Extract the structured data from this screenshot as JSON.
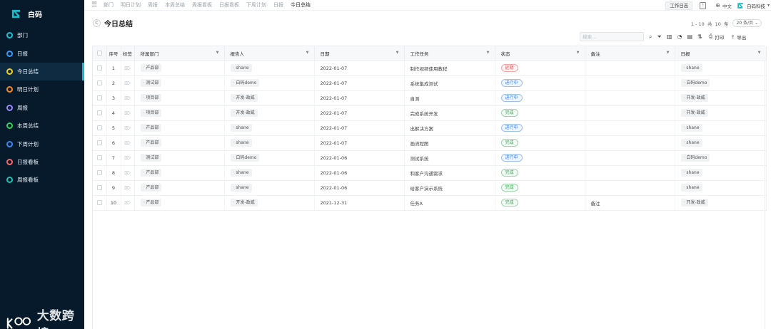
{
  "app": {
    "name": "白码",
    "brand_color": "#18b8c8"
  },
  "sidebar": {
    "items": [
      {
        "label": "部门",
        "ring_color": "#19c2cc",
        "active": false
      },
      {
        "label": "日报",
        "ring_color": "#3b9cf5",
        "active": false
      },
      {
        "label": "今日总结",
        "ring_color": "#f5d11c",
        "active": true
      },
      {
        "label": "明日计划",
        "ring_color": "#f08a2a",
        "active": false
      },
      {
        "label": "周报",
        "ring_color": "#9b8af7",
        "active": false
      },
      {
        "label": "本周总结",
        "ring_color": "#2dd35c",
        "active": false
      },
      {
        "label": "下周计划",
        "ring_color": "#3b86f5",
        "active": false
      },
      {
        "label": "日报看板",
        "ring_color": "#f06a6a",
        "active": false
      },
      {
        "label": "周报看板",
        "ring_color": "#19c2b5",
        "active": false
      }
    ],
    "watermark": "大数跨境"
  },
  "topbar": {
    "menu_icon": "menu-fold-icon",
    "tabs": [
      {
        "label": "部门",
        "active": false
      },
      {
        "label": "明日计划",
        "active": false
      },
      {
        "label": "周报",
        "active": false
      },
      {
        "label": "本周总结",
        "active": false
      },
      {
        "label": "周报看板",
        "active": false
      },
      {
        "label": "日报看板",
        "active": false
      },
      {
        "label": "下周计划",
        "active": false
      },
      {
        "label": "日报",
        "active": false
      },
      {
        "label": "今日总结",
        "active": true
      }
    ],
    "work_log_label": "工作日志",
    "language": "中文",
    "org_name": "白码科技"
  },
  "page": {
    "title": "今日总结",
    "pagination_text": "1 - 10  共  10  条",
    "page_size": "20 条/页"
  },
  "toolbar": {
    "search_placeholder": "搜索...",
    "print_label": "打印",
    "export_label": "导出"
  },
  "table": {
    "columns": [
      {
        "key": "check",
        "label": ""
      },
      {
        "key": "index",
        "label": "序号"
      },
      {
        "key": "tag",
        "label": "标签"
      },
      {
        "key": "dept",
        "label": "所属部门"
      },
      {
        "key": "reporter",
        "label": "报告人"
      },
      {
        "key": "date",
        "label": "日期"
      },
      {
        "key": "task",
        "label": "工作任务"
      },
      {
        "key": "status",
        "label": "状态"
      },
      {
        "key": "remark",
        "label": "备注"
      },
      {
        "key": "daily",
        "label": "日报"
      }
    ],
    "rows": [
      {
        "index": "1",
        "dept": "产品部",
        "reporter": "shane",
        "date": "2022-01-07",
        "task": "制作视频使用教程",
        "status": "延期",
        "status_type": "red",
        "remark": "",
        "daily": "shane"
      },
      {
        "index": "2",
        "dept": "测试部",
        "reporter": "白码demo",
        "date": "2022-01-07",
        "task": "系统集成测试",
        "status": "进行中",
        "status_type": "blue",
        "remark": "",
        "daily": "白码demo"
      },
      {
        "index": "3",
        "dept": "项目部",
        "reporter": "开发-政威",
        "date": "2022-01-07",
        "task": "自测",
        "status": "进行中",
        "status_type": "blue",
        "remark": "",
        "daily": "开发-政威"
      },
      {
        "index": "4",
        "dept": "项目部",
        "reporter": "开发-政威",
        "date": "2022-01-07",
        "task": "完成系统开发",
        "status": "完成",
        "status_type": "green",
        "remark": "",
        "daily": "开发-政威"
      },
      {
        "index": "5",
        "dept": "产品部",
        "reporter": "shane",
        "date": "2022-01-07",
        "task": "出解决方案",
        "status": "进行中",
        "status_type": "blue",
        "remark": "",
        "daily": "shane"
      },
      {
        "index": "6",
        "dept": "产品部",
        "reporter": "shane",
        "date": "2022-01-07",
        "task": "画流程图",
        "status": "完成",
        "status_type": "green",
        "remark": "",
        "daily": "shane"
      },
      {
        "index": "7",
        "dept": "测试部",
        "reporter": "白码demo",
        "date": "2022-01-06",
        "task": "测试系统",
        "status": "进行中",
        "status_type": "blue",
        "remark": "",
        "daily": "白码demo"
      },
      {
        "index": "8",
        "dept": "产品部",
        "reporter": "shane",
        "date": "2022-01-06",
        "task": "和客户沟通需求",
        "status": "完成",
        "status_type": "green",
        "remark": "",
        "daily": "shane"
      },
      {
        "index": "9",
        "dept": "产品部",
        "reporter": "shane",
        "date": "2022-01-06",
        "task": "给客户演示系统",
        "status": "完成",
        "status_type": "green",
        "remark": "",
        "daily": "shane"
      },
      {
        "index": "10",
        "dept": "产品部",
        "reporter": "开发-政威",
        "date": "2021-12-31",
        "task": "任务A",
        "status": "完成",
        "status_type": "green",
        "remark": "备注",
        "daily": "开发-政威"
      }
    ]
  }
}
